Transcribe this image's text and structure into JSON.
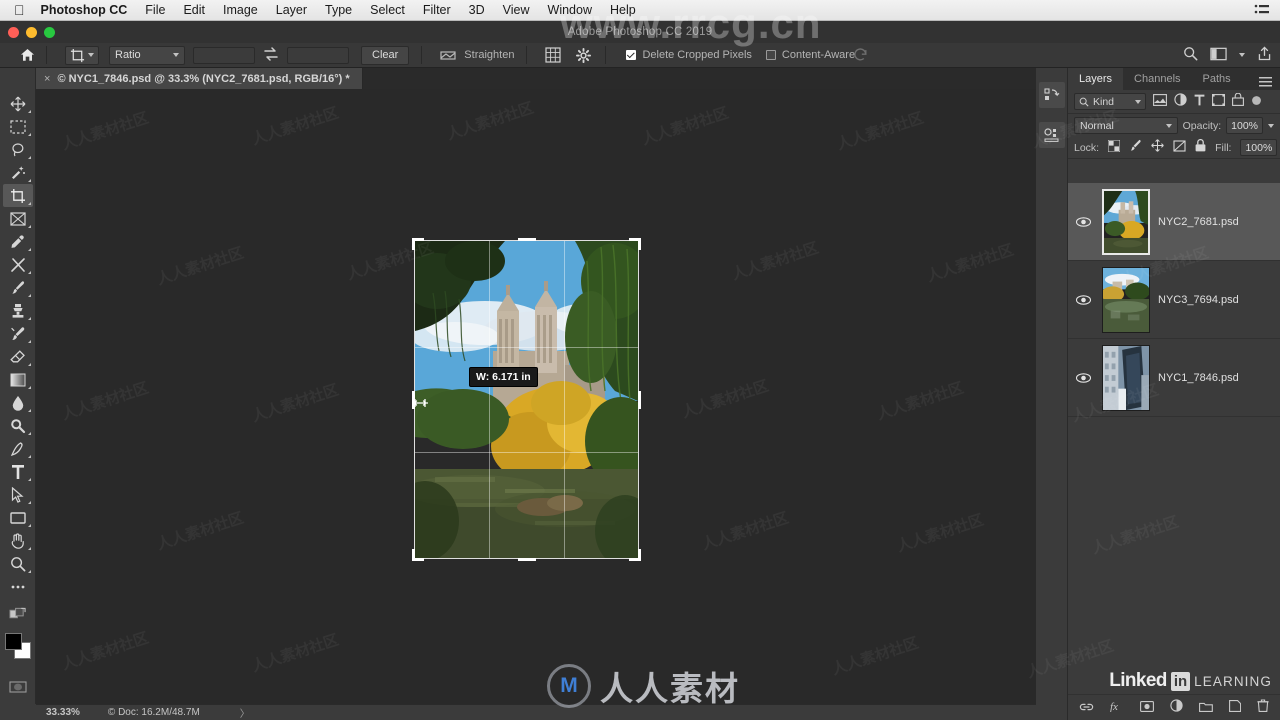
{
  "macbar": {
    "apple_icon": "apple-icon",
    "app_name": "Photoshop CC",
    "menus": [
      "File",
      "Edit",
      "Image",
      "Layer",
      "Type",
      "Select",
      "Filter",
      "3D",
      "View",
      "Window",
      "Help"
    ],
    "right_icon": "list-menu-icon"
  },
  "titlebar": {
    "title": "Adobe Photoshop CC 2019",
    "close": "close-button",
    "minimize": "minimize-button",
    "maximize": "maximize-button"
  },
  "options_bar": {
    "home_icon": "home-icon",
    "tool_icon": "crop-tool-icon",
    "ratio_label": "Ratio",
    "width_value": "",
    "width_placeholder": "",
    "height_value": "",
    "height_placeholder": "",
    "swap_icon": "swap-arrows-icon",
    "clear_label": "Clear",
    "straighten_icon": "straighten-icon",
    "straighten_label": "Straighten",
    "overlay_icon": "grid-overlay-icon",
    "settings_icon": "gear-icon",
    "delete_cropped_label": "Delete Cropped Pixels",
    "delete_cropped_checked": true,
    "content_aware_label": "Content-Aware",
    "content_aware_checked": false,
    "reset_icon": "reset-icon",
    "search_icon": "search-icon",
    "workspace_icon": "workspace-icon",
    "share_icon": "share-icon"
  },
  "document_tab": {
    "close_glyph": "×",
    "title": "© NYC1_7846.psd @ 33.3% (NYC2_7681.psd, RGB/16°) *"
  },
  "toolbar": {
    "tools": [
      {
        "name": "move-tool",
        "active": false
      },
      {
        "name": "rectangular-marquee-tool",
        "active": false
      },
      {
        "name": "lasso-tool",
        "active": false
      },
      {
        "name": "quick-selection-tool",
        "active": false
      },
      {
        "name": "crop-tool",
        "active": true
      },
      {
        "name": "frame-tool",
        "active": false
      },
      {
        "name": "eyedropper-tool",
        "active": false
      },
      {
        "name": "healing-brush-tool",
        "active": false
      },
      {
        "name": "brush-tool",
        "active": false
      },
      {
        "name": "clone-stamp-tool",
        "active": false
      },
      {
        "name": "history-brush-tool",
        "active": false
      },
      {
        "name": "eraser-tool",
        "active": false
      },
      {
        "name": "gradient-tool",
        "active": false
      },
      {
        "name": "blur-tool",
        "active": false
      },
      {
        "name": "dodge-tool",
        "active": false
      },
      {
        "name": "pen-tool",
        "active": false
      },
      {
        "name": "type-tool",
        "active": false
      },
      {
        "name": "path-selection-tool",
        "active": false
      },
      {
        "name": "rectangle-tool",
        "active": false
      },
      {
        "name": "hand-tool",
        "active": false
      },
      {
        "name": "zoom-tool",
        "active": false
      },
      {
        "name": "edit-toolbar-tool",
        "active": false
      }
    ],
    "quickmask_icon": "quick-mask-icon",
    "screenmode_icon": "screen-mode-icon",
    "foreground_color": "#000000",
    "background_color": "#ffffff"
  },
  "canvas": {
    "crop": {
      "tooltip": "W: 6.171 in",
      "cursor": "resize-horizontal-cursor"
    }
  },
  "dock": {
    "history_icon": "history-panel-icon",
    "properties_icon": "properties-panel-icon"
  },
  "layers_panel": {
    "tabs": [
      {
        "label": "Layers",
        "active": true
      },
      {
        "label": "Channels",
        "active": false
      },
      {
        "label": "Paths",
        "active": false
      }
    ],
    "menu_icon": "panel-menu-icon",
    "filter": {
      "search_icon": "search-icon",
      "kind_label": "Kind",
      "icons": [
        "image-filter-icon",
        "adjustment-filter-icon",
        "type-filter-icon",
        "shape-filter-icon",
        "smartobject-filter-icon"
      ],
      "toggle_icon": "filter-toggle-icon"
    },
    "blend_mode": "Normal",
    "opacity_label": "Opacity:",
    "opacity_value": "100%",
    "lock_label": "Lock:",
    "lock_icons": [
      "lock-transparent-pixels-icon",
      "lock-image-pixels-icon",
      "lock-position-icon",
      "lock-artboard-icon",
      "lock-all-icon"
    ],
    "fill_label": "Fill:",
    "fill_value": "100%",
    "layers": [
      {
        "name": "NYC2_7681.psd",
        "visible": true,
        "selected": true,
        "thumb": "central-park-towers"
      },
      {
        "name": "NYC3_7694.psd",
        "visible": true,
        "selected": false,
        "thumb": "central-park-reflection"
      },
      {
        "name": "NYC1_7846.psd",
        "visible": true,
        "selected": false,
        "thumb": "city-skyscrapers"
      }
    ],
    "footer_icons": [
      "link-layers-icon",
      "layer-style-fx-icon",
      "layer-mask-icon",
      "adjustment-layer-icon",
      "group-layers-icon",
      "new-layer-icon",
      "delete-layer-icon"
    ]
  },
  "branding": {
    "linked": "Linked",
    "in": "in",
    "learning": "LEARNING"
  },
  "watermarks": {
    "top_url": "www.rrcg.cn",
    "center_text": "人人素材",
    "center_mark": "M",
    "tiled_text": "人人素材社区"
  },
  "status_bar": {
    "zoom": "33.33%",
    "doc_info": "© Doc: 16.2M/48.7M",
    "expand_glyph": "〉"
  }
}
